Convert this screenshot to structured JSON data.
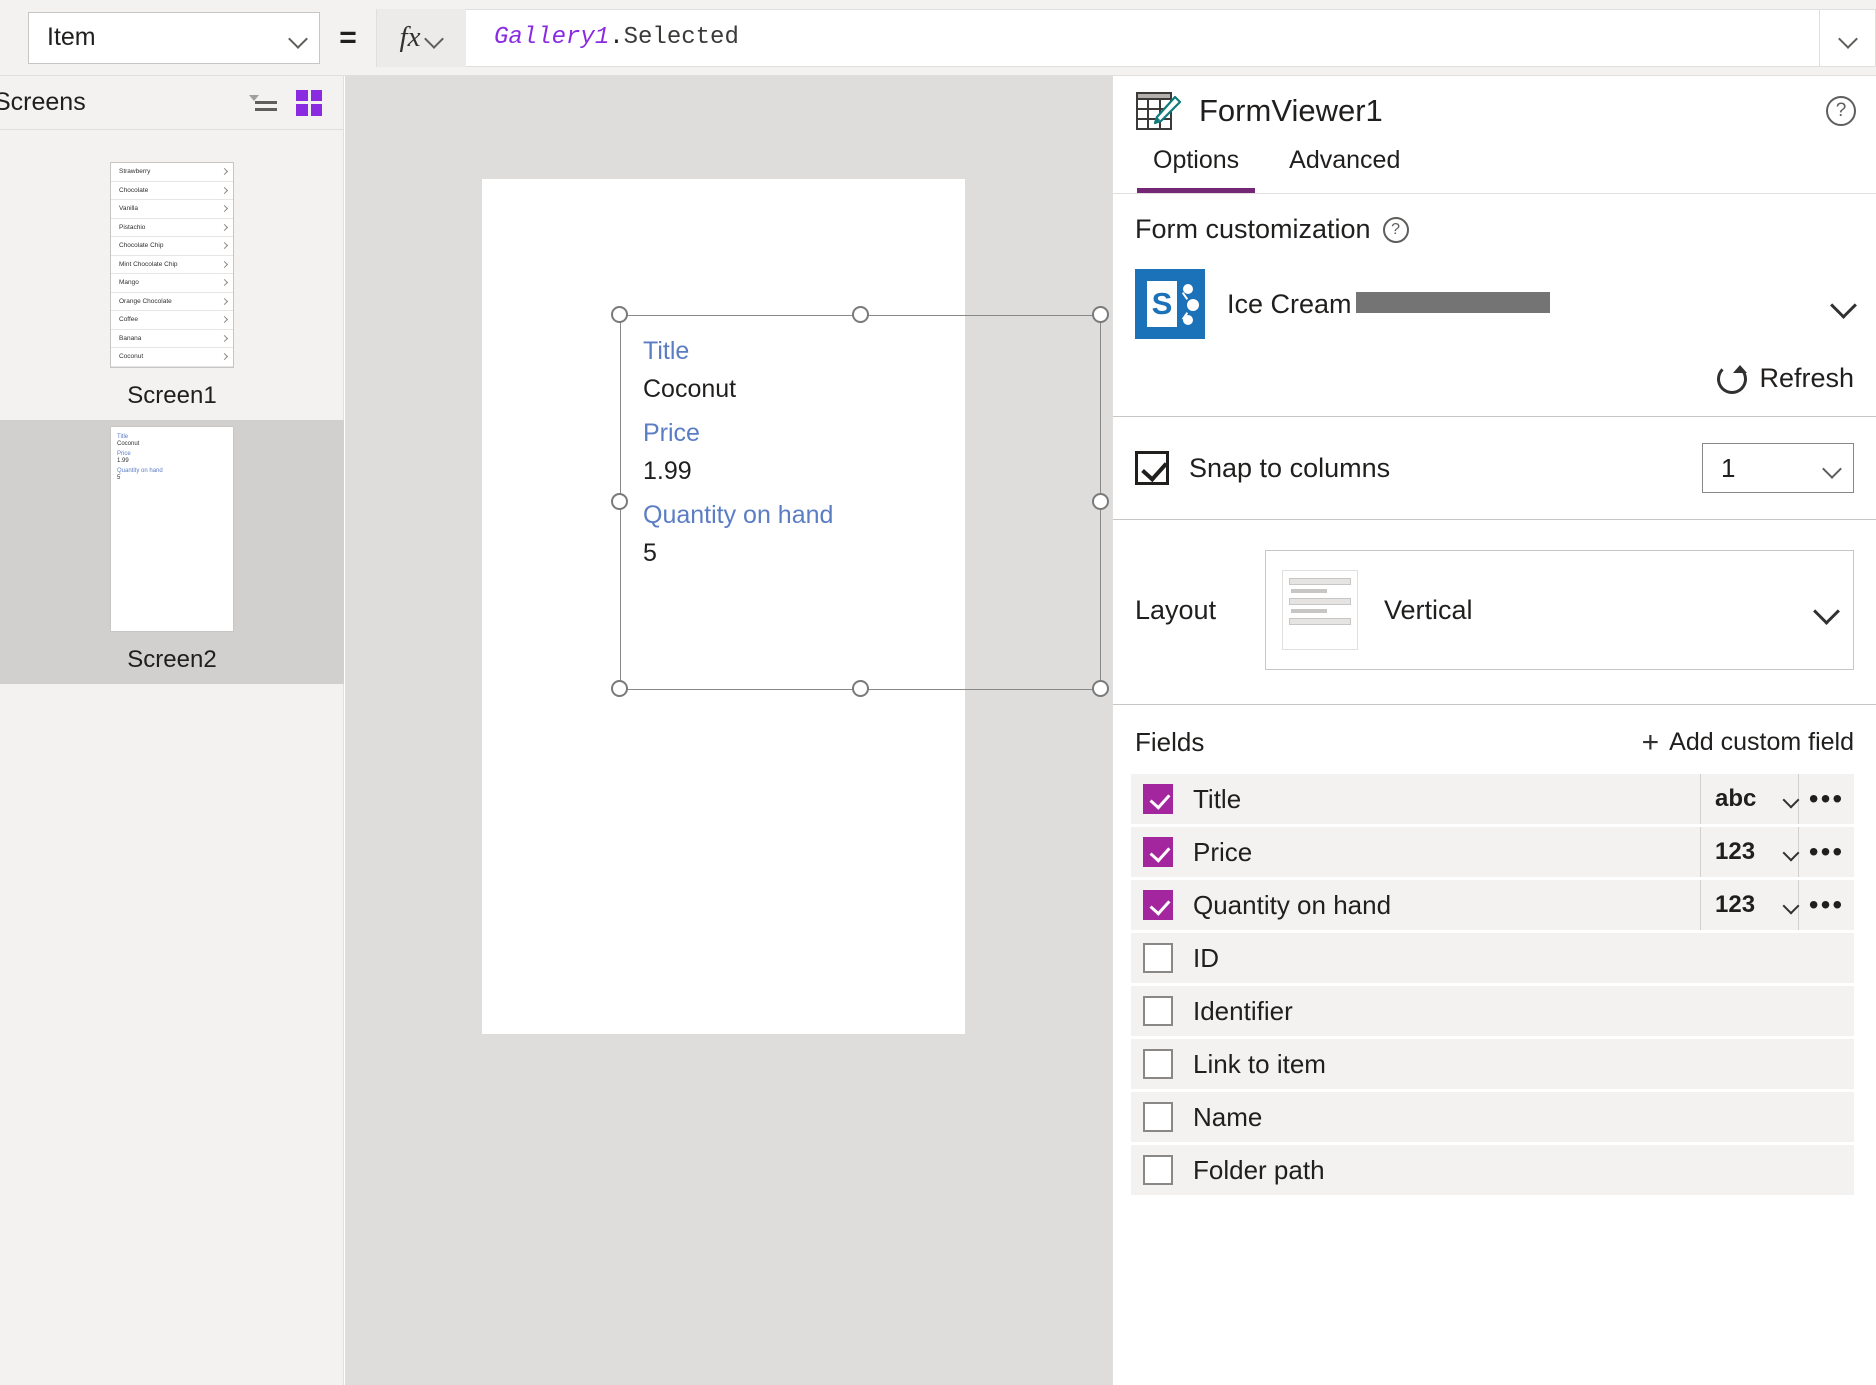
{
  "formula_bar": {
    "property": "Item",
    "equals": "=",
    "fx_label": "fx",
    "formula_identifier": "Gallery1",
    "formula_dot": ".",
    "formula_property": "Selected"
  },
  "tree_panel": {
    "title": "Screens",
    "screens": [
      {
        "label": "Screen1",
        "type": "gallery",
        "items": [
          "Strawberry",
          "Chocolate",
          "Vanilla",
          "Pistachio",
          "Chocolate Chip",
          "Mint Chocolate Chip",
          "Mango",
          "Orange Chocolate",
          "Coffee",
          "Banana",
          "Coconut"
        ]
      },
      {
        "label": "Screen2",
        "type": "form",
        "selected": true,
        "fields": [
          {
            "label": "Title",
            "value": "Coconut"
          },
          {
            "label": "Price",
            "value": "1.99"
          },
          {
            "label": "Quantity on hand",
            "value": "5"
          }
        ]
      }
    ]
  },
  "canvas": {
    "form": {
      "fields": [
        {
          "label": "Title",
          "value": "Coconut"
        },
        {
          "label": "Price",
          "value": "1.99"
        },
        {
          "label": "Quantity on hand",
          "value": "5"
        }
      ]
    }
  },
  "right_panel": {
    "control_name": "FormViewer1",
    "help_glyph": "?",
    "tabs": [
      {
        "label": "Options",
        "active": true
      },
      {
        "label": "Advanced",
        "active": false
      }
    ],
    "form_customization": {
      "title": "Form customization",
      "help_glyph": "?",
      "data_source": {
        "name": "Ice Cream",
        "account_redacted": true,
        "connector": "SharePoint",
        "icon_letter": "S"
      },
      "refresh_label": "Refresh"
    },
    "snap_to_columns": {
      "label": "Snap to columns",
      "checked": true,
      "columns_value": "1"
    },
    "layout": {
      "label": "Layout",
      "value": "Vertical"
    },
    "fields_section": {
      "title": "Fields",
      "add_label": "Add custom field",
      "add_glyph": "+",
      "more_glyph": "•••",
      "rows": [
        {
          "name": "Title",
          "checked": true,
          "type": "abc",
          "has_type": true
        },
        {
          "name": "Price",
          "checked": true,
          "type": "123",
          "has_type": true
        },
        {
          "name": "Quantity on hand",
          "checked": true,
          "type": "123",
          "has_type": true
        },
        {
          "name": "ID",
          "checked": false,
          "type": "",
          "has_type": false
        },
        {
          "name": "Identifier",
          "checked": false,
          "type": "",
          "has_type": false
        },
        {
          "name": "Link to item",
          "checked": false,
          "type": "",
          "has_type": false
        },
        {
          "name": "Name",
          "checked": false,
          "type": "",
          "has_type": false
        },
        {
          "name": "Folder path",
          "checked": false,
          "type": "",
          "has_type": false
        }
      ]
    }
  },
  "colors": {
    "accent_purple": "#742774",
    "checkbox_magenta": "#a4269e",
    "form_label_blue": "#5b7dc4",
    "sharepoint_blue": "#1b72b8",
    "formula_identifier": "#8a2be2"
  }
}
